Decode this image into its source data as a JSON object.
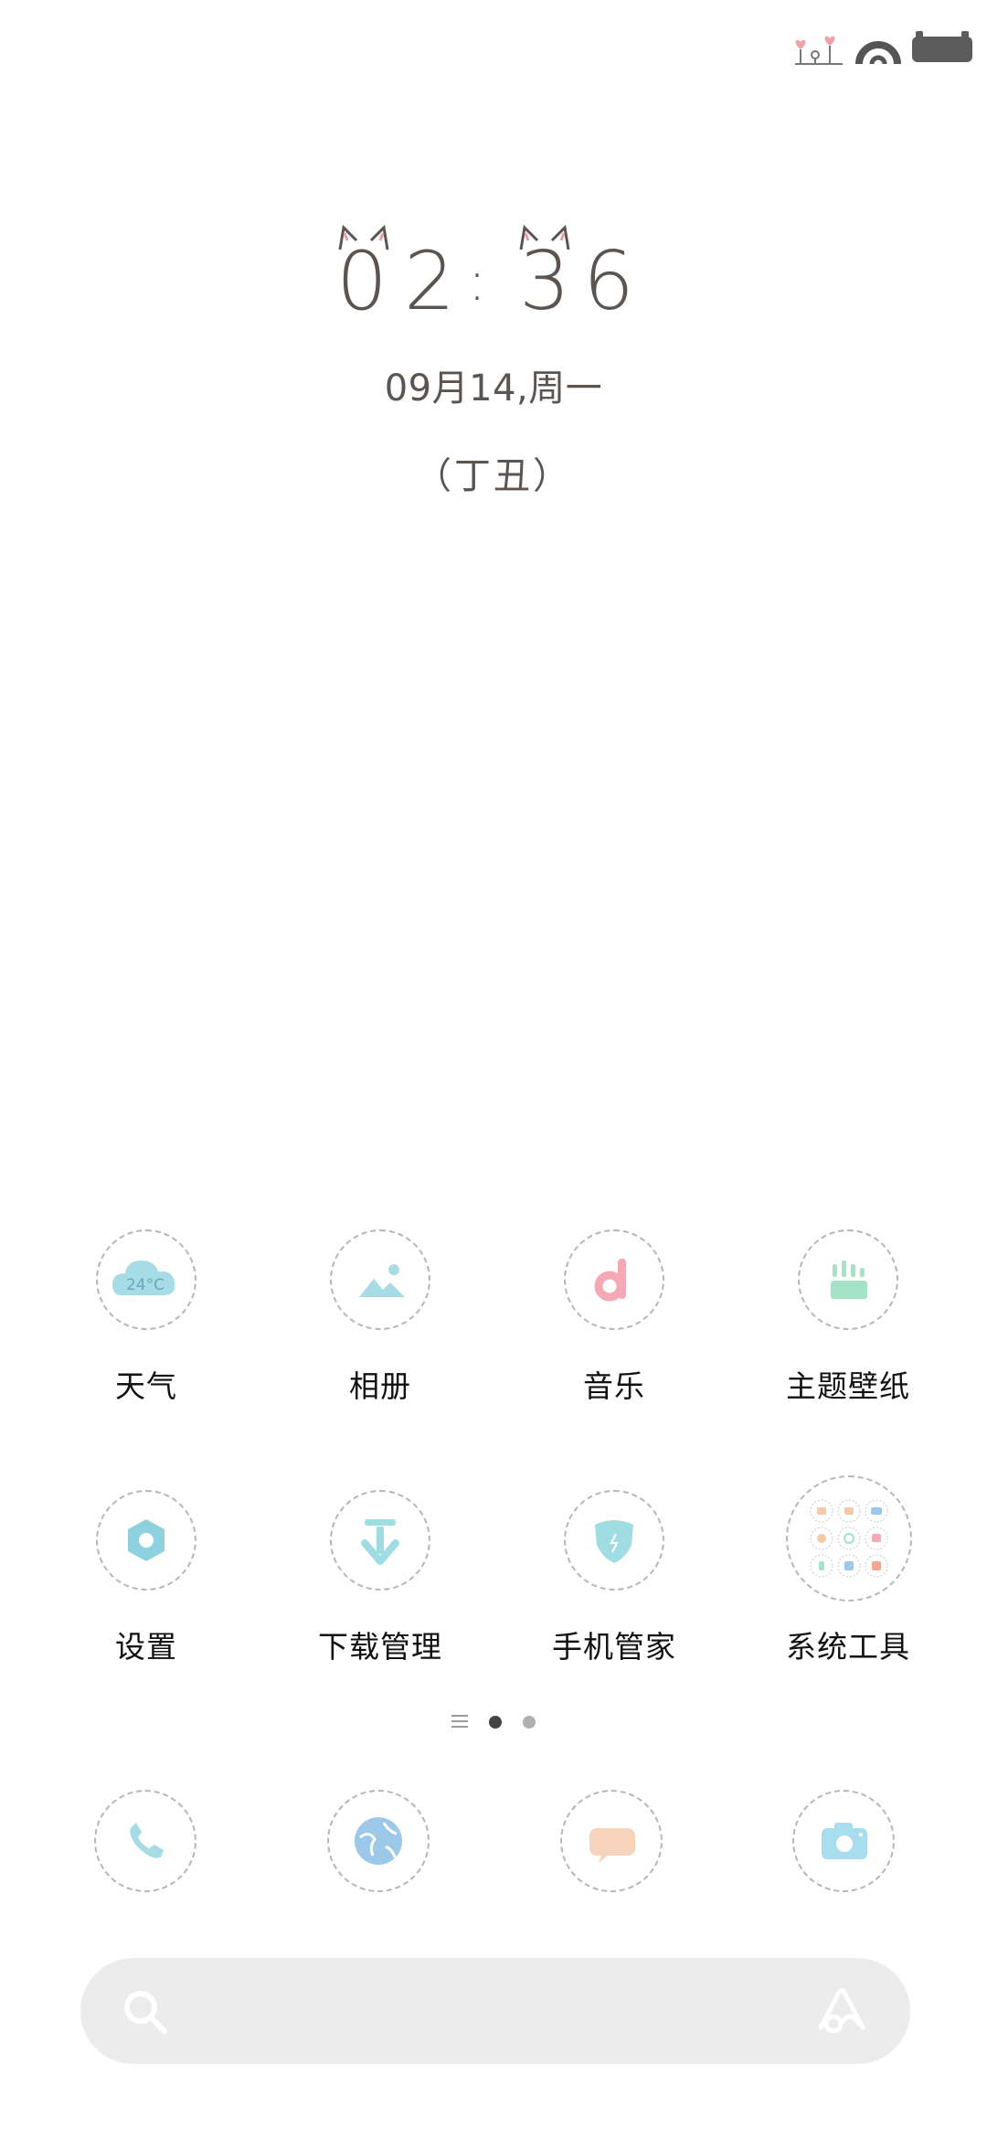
{
  "status_bar": {
    "icons": [
      "hearts-decoration-icon",
      "rainbow-signal-icon",
      "battery-icon"
    ],
    "battery_color": "#5c5c5c"
  },
  "lock_clock": {
    "time": "02:36",
    "digits": [
      "0",
      "2",
      "3",
      "6"
    ],
    "separator": ":",
    "date": "09月14,周一",
    "lunar": "（丁丑）",
    "text_color": "#5b5552"
  },
  "apps": [
    {
      "label": "天气",
      "icon": "weather-icon",
      "badge_text": "24°C",
      "color": "#a7dbe6"
    },
    {
      "label": "相册",
      "icon": "gallery-icon",
      "color": "#a7dbe6"
    },
    {
      "label": "音乐",
      "icon": "music-icon",
      "color": "#f4a9b4"
    },
    {
      "label": "主题壁纸",
      "icon": "theme-wallpaper-icon",
      "color": "#a4e3c6"
    },
    {
      "label": "设置",
      "icon": "settings-icon",
      "color": "#8ed1df"
    },
    {
      "label": "下载管理",
      "icon": "download-icon",
      "color": "#9fdde3"
    },
    {
      "label": "手机管家",
      "icon": "security-shield-icon",
      "color": "#9fdde3"
    },
    {
      "label": "系统工具",
      "icon": "system-tools-folder-icon",
      "color": "#f5c8a8"
    }
  ],
  "page_indicator": {
    "pages": 2,
    "active_index": 0,
    "active_color": "#444444",
    "inactive_color": "#b0b0b0"
  },
  "dock": [
    {
      "name": "phone",
      "icon": "phone-icon",
      "color": "#a7dbe6"
    },
    {
      "name": "browser",
      "icon": "browser-globe-icon",
      "color": "#9cc9ea"
    },
    {
      "name": "messages",
      "icon": "messages-icon",
      "color": "#f6d3bb"
    },
    {
      "name": "camera",
      "icon": "camera-icon",
      "color": "#a8dcef"
    }
  ],
  "search_bar": {
    "placeholder": "",
    "left_icon": "search-icon",
    "right_icon": "assistant-icon",
    "background": "#ececec"
  }
}
